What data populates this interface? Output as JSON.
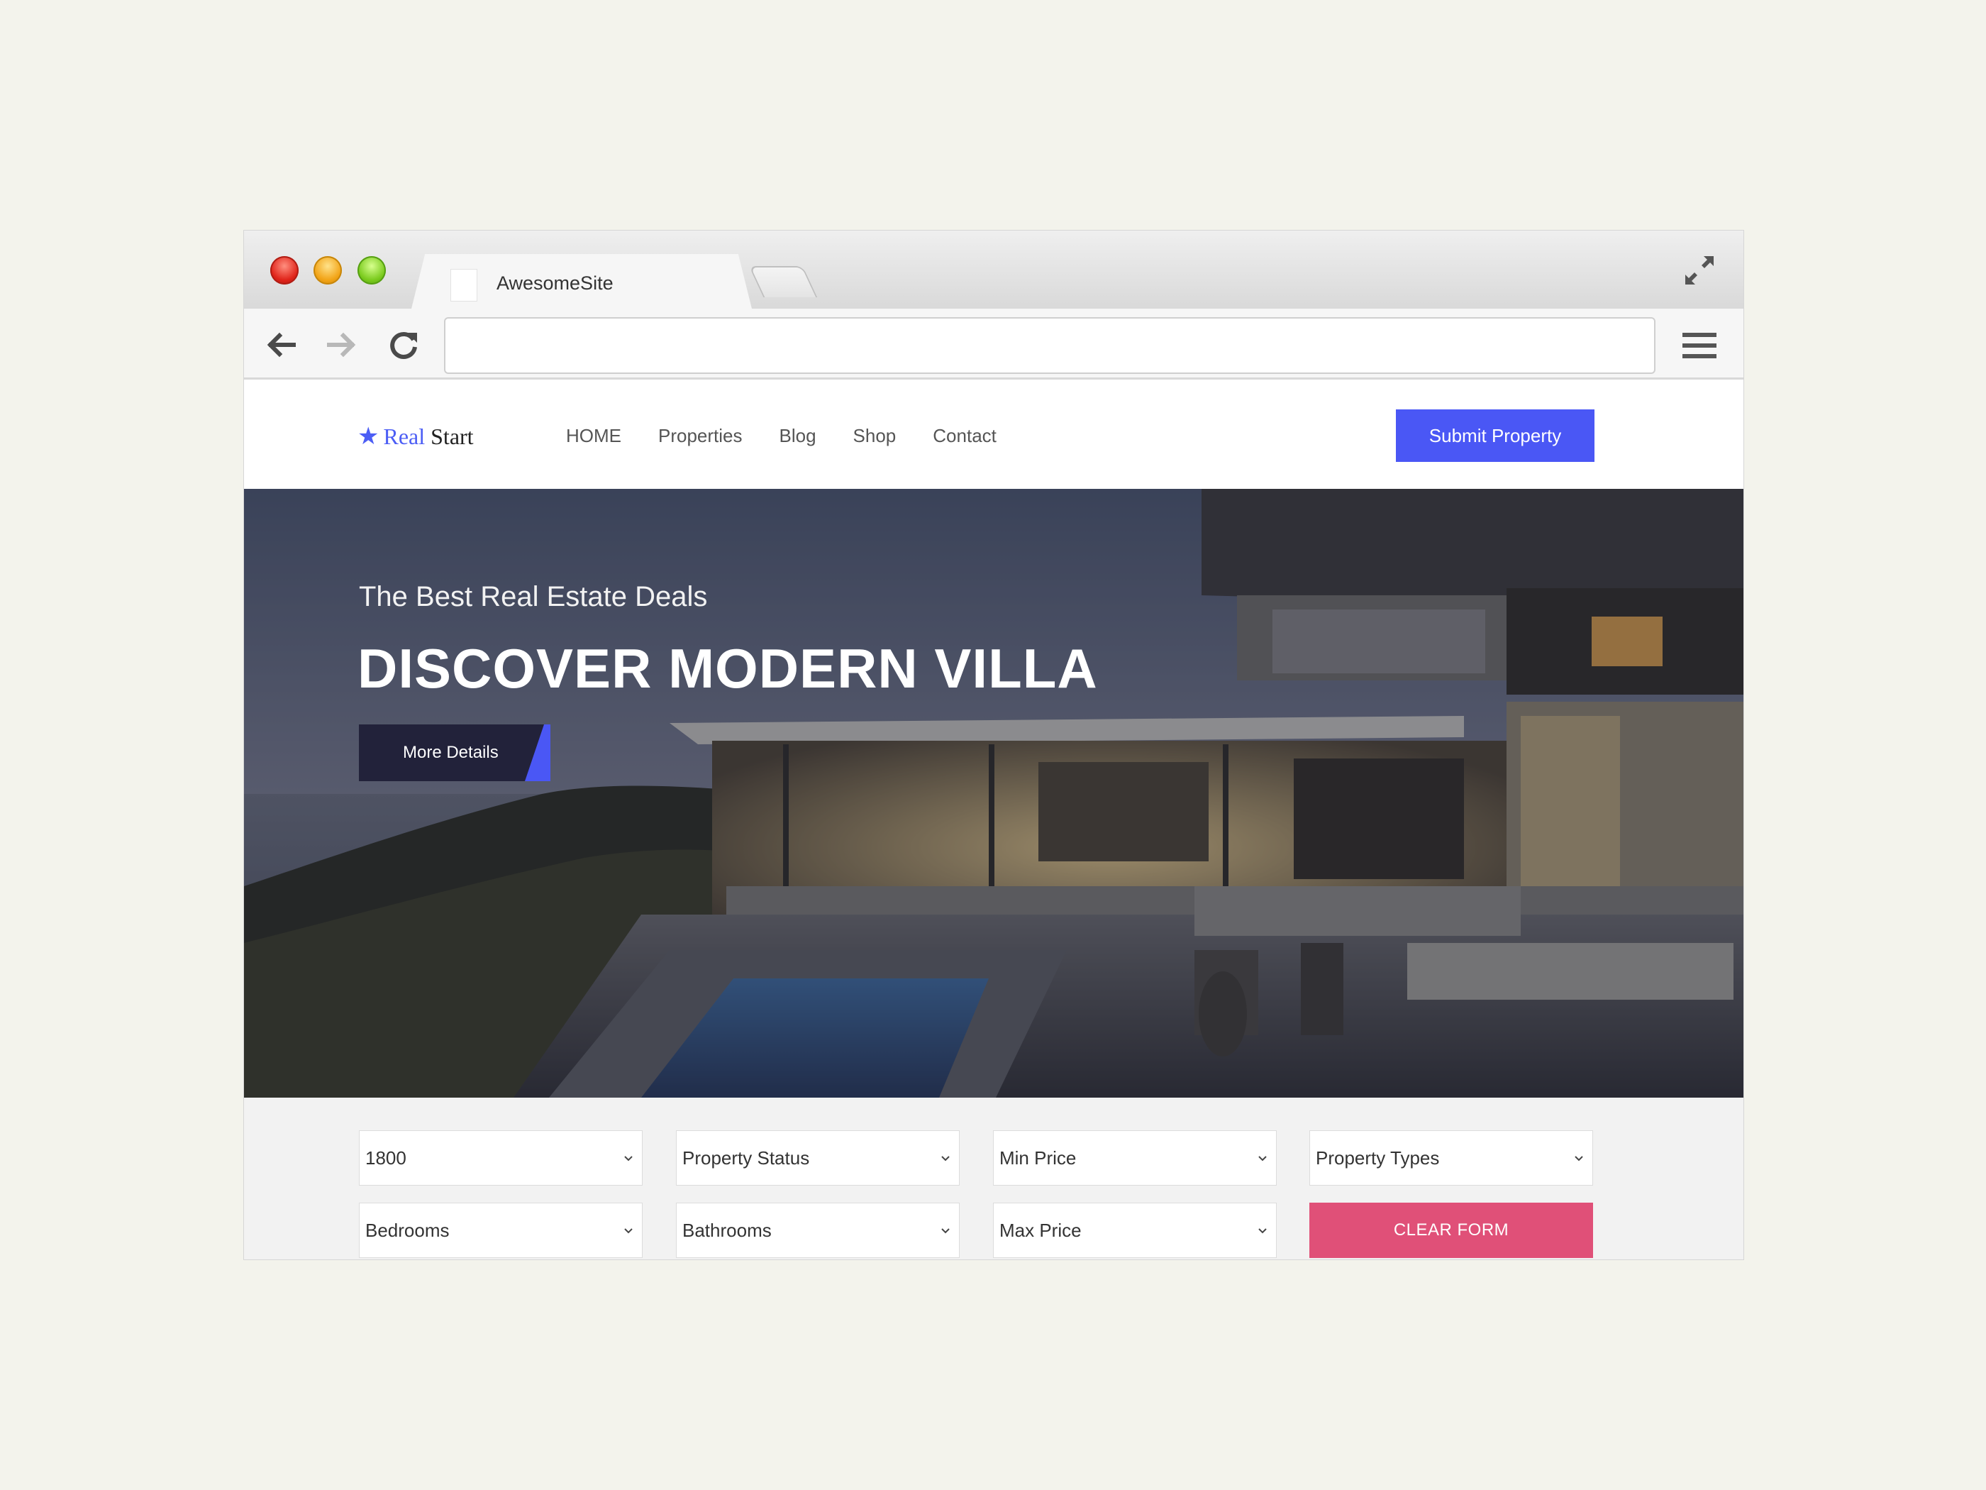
{
  "browser": {
    "tab_title": "AwesomeSite",
    "url": ""
  },
  "site": {
    "logo_part1": "Real",
    "logo_part2": "Start",
    "nav": [
      "HOME",
      "Properties",
      "Blog",
      "Shop",
      "Contact"
    ],
    "submit_label": "Submit Property",
    "accent_color": "#4a57f5"
  },
  "hero": {
    "subtitle": "The Best Real Estate Deals",
    "title": "DISCOVER MODERN VILLA",
    "button_label": "More Details"
  },
  "search": {
    "fields": [
      {
        "value": "1800"
      },
      {
        "value": "Property Status"
      },
      {
        "value": "Min Price"
      },
      {
        "value": "Property Types"
      },
      {
        "value": "Bedrooms"
      },
      {
        "value": "Bathrooms"
      },
      {
        "value": "Max Price"
      }
    ],
    "clear_label": "CLEAR FORM",
    "clear_color": "#e05078"
  }
}
